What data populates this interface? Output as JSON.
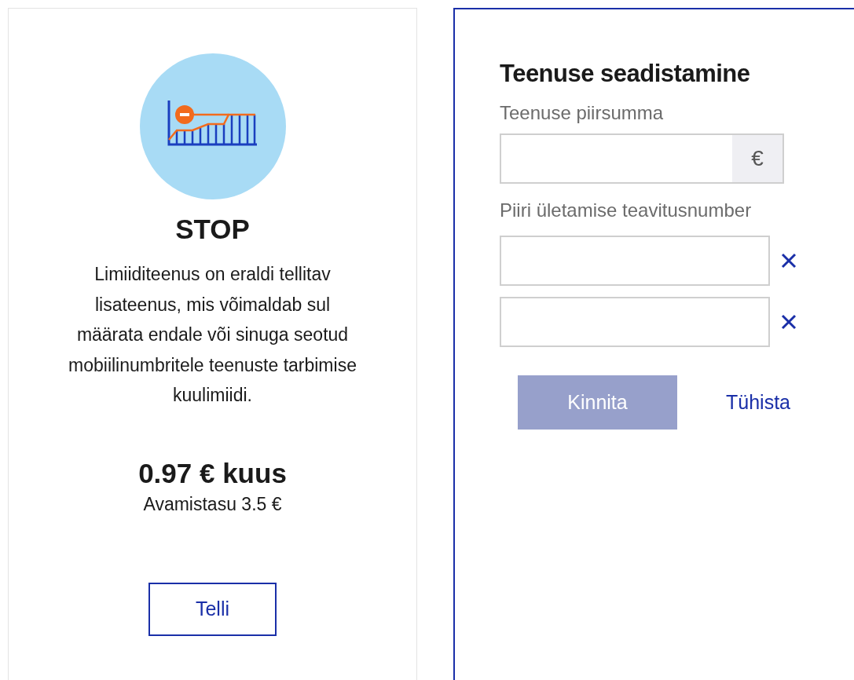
{
  "offer": {
    "title": "STOP",
    "description": "Limiiditeenus on eraldi tellitav lisateenus, mis võimaldab sul määrata endale või sinuga seotud mobiilinumbritele teenuste tarbimise kuulimiidi.",
    "price": "0.97 € kuus",
    "fee": "Avamistasu 3.5 €",
    "button": "Telli"
  },
  "settings": {
    "title": "Teenuse seadistamine",
    "limit_label": "Teenuse piirsumma",
    "currency": "€",
    "notify_label": "Piiri ületamise teavitusnumber",
    "notify_fields": [
      {
        "removable": true
      },
      {
        "removable": true
      }
    ],
    "confirm": {
      "label": "Kinnita",
      "disabled": true
    },
    "cancel": "Tühista"
  }
}
